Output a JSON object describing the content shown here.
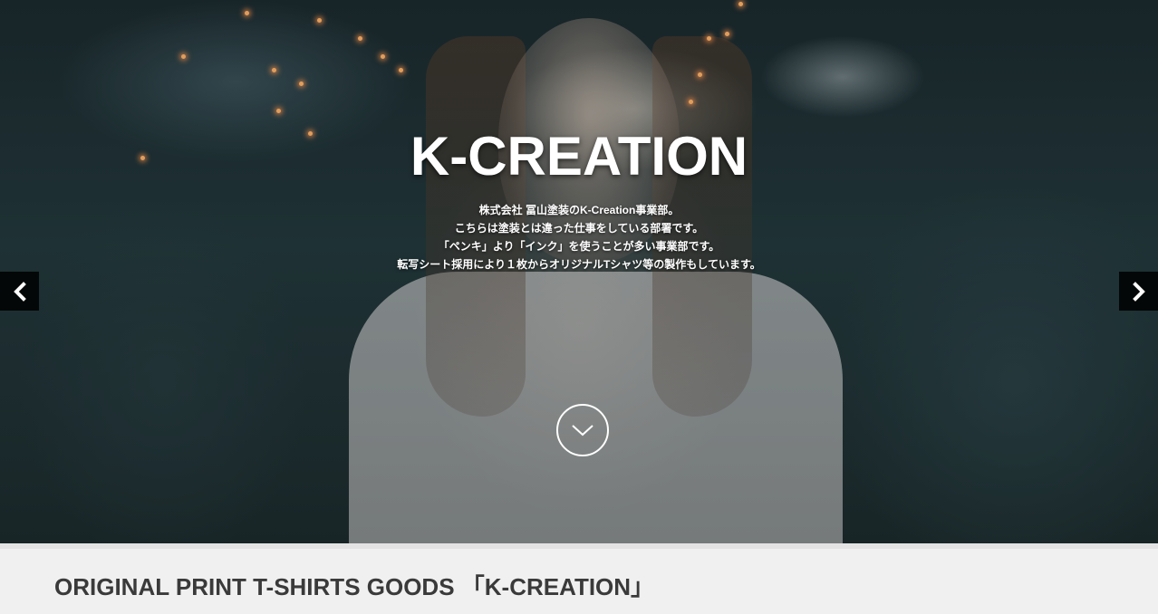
{
  "hero": {
    "title": "K-CREATION",
    "lines": [
      "株式会社 冨山塗装のK-Creation事業部。",
      "こちらは塗装とは違った仕事をしている部署です。",
      "「ペンキ」より「インク」を使うことが多い事業部です。",
      "転写シート採用により１枚からオリジナルTシャツ等の製作もしています。"
    ],
    "prev_icon": "chevron-left-icon",
    "next_icon": "chevron-right-icon",
    "scroll_icon": "chevron-down-icon"
  },
  "section": {
    "title": "ORIGINAL PRINT T-SHIRTS GOODS 「K-CREATION」"
  },
  "colors": {
    "hero_text": "#ffffff",
    "arrow_bg": "#000000",
    "band_bg": "#f0f0f0",
    "section_title": "#3a3a3a"
  }
}
